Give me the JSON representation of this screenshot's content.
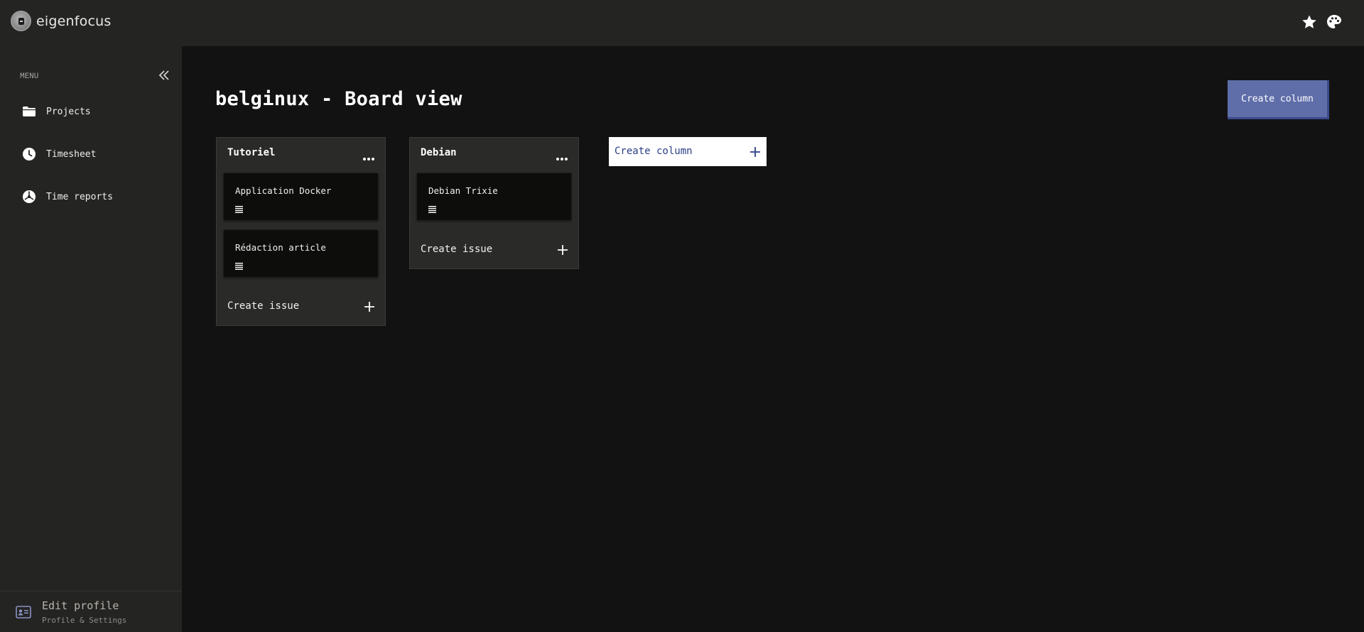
{
  "app": {
    "brand_name": "eigenfocus",
    "logo_icon": "eigenfocus-logo-icon",
    "top_icons": [
      "star-icon",
      "palette-icon"
    ]
  },
  "sidebar": {
    "menu_label": "MENU",
    "collapse_icon": "double-chevron-left-icon",
    "items": [
      {
        "label": "Projects",
        "icon": "folder-icon"
      },
      {
        "label": "Timesheet",
        "icon": "clock-icon"
      },
      {
        "label": "Time reports",
        "icon": "chart-pie-icon"
      }
    ],
    "profile": {
      "title": "Edit profile",
      "subtitle": "Profile & Settings",
      "icon": "id-card-icon"
    }
  },
  "main": {
    "title": "belginux - Board view",
    "create_column_button": "Create column",
    "columns": [
      {
        "name": "Tutoriel",
        "issues": [
          {
            "title": "Application Docker"
          },
          {
            "title": "Rédaction article"
          }
        ],
        "create_issue_label": "Create issue"
      },
      {
        "name": "Debian",
        "issues": [
          {
            "title": "Debian Trixie"
          }
        ],
        "create_issue_label": "Create issue"
      }
    ],
    "create_column_inline": "Create column"
  },
  "colors": {
    "background": "#121212",
    "panel": "#242422",
    "column": "#2a2a28",
    "card": "#0d0d0c",
    "accent": "#5f6ea9",
    "link_blue": "#2c3f86"
  }
}
